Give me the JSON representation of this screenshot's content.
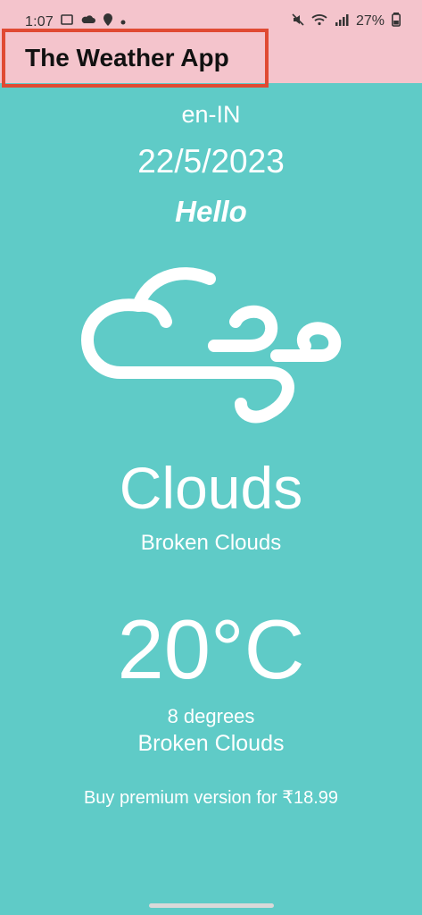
{
  "status_bar": {
    "time": "1:07",
    "battery": "27%",
    "icons": [
      "message-icon",
      "cloud-icon",
      "location-icon",
      "dot-icon",
      "mute-icon",
      "wifi-icon",
      "signal-icon",
      "battery-icon"
    ]
  },
  "header": {
    "title": "The Weather App",
    "highlight_color": "#e04a33",
    "background_color": "#f4c4cc"
  },
  "main": {
    "locale": "en-IN",
    "date": "22/5/2023",
    "greeting": "Hello",
    "weather_icon": "cloud-wind-icon",
    "condition": "Clouds",
    "description": "Broken Clouds",
    "temperature": "20°C",
    "feels_like": "8 degrees",
    "description_2": "Broken Clouds",
    "premium_text": "Buy premium version for ₹18.99",
    "background_color": "#5fcbc7"
  }
}
